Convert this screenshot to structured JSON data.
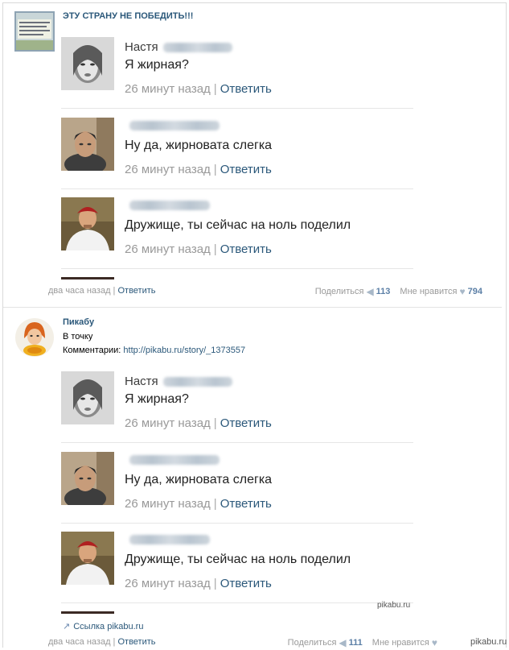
{
  "post1": {
    "title": "ЭТУ СТРАНУ НЕ ПОБЕДИТЬ!!!",
    "footer": {
      "time": "два часа назад",
      "sep": "|",
      "reply": "Ответить",
      "share": "Поделиться",
      "share_count": "113",
      "like": "Мне нравится",
      "like_count": "794"
    }
  },
  "post2": {
    "title": "Пикабу",
    "text1": "В точку",
    "comments_label": "Комментарии:",
    "comments_url": "http://pikabu.ru/story/_1373557",
    "link_label": "Ссылка pikabu.ru",
    "footer": {
      "time": "два часа назад",
      "sep": "|",
      "reply": "Ответить",
      "share": "Поделиться",
      "share_count": "111",
      "like": "Мне нравится"
    }
  },
  "comments": [
    {
      "name": "Настя",
      "text": "Я жирная?",
      "time": "26 минут назад",
      "sep": "|",
      "reply": "Ответить"
    },
    {
      "name": "",
      "text": "Ну да, жирновата слегка",
      "time": "26 минут назад",
      "sep": "|",
      "reply": "Ответить"
    },
    {
      "name": "",
      "text": "Дружище, ты сейчас на ноль поделил",
      "time": "26 минут назад",
      "sep": "|",
      "reply": "Ответить"
    }
  ],
  "watermarks": {
    "mid": "pikabu.ru",
    "corner": "pikabu.ru"
  },
  "colors": {
    "link": "#2b587a",
    "muted": "#999999",
    "count": "#5b7fa6"
  }
}
